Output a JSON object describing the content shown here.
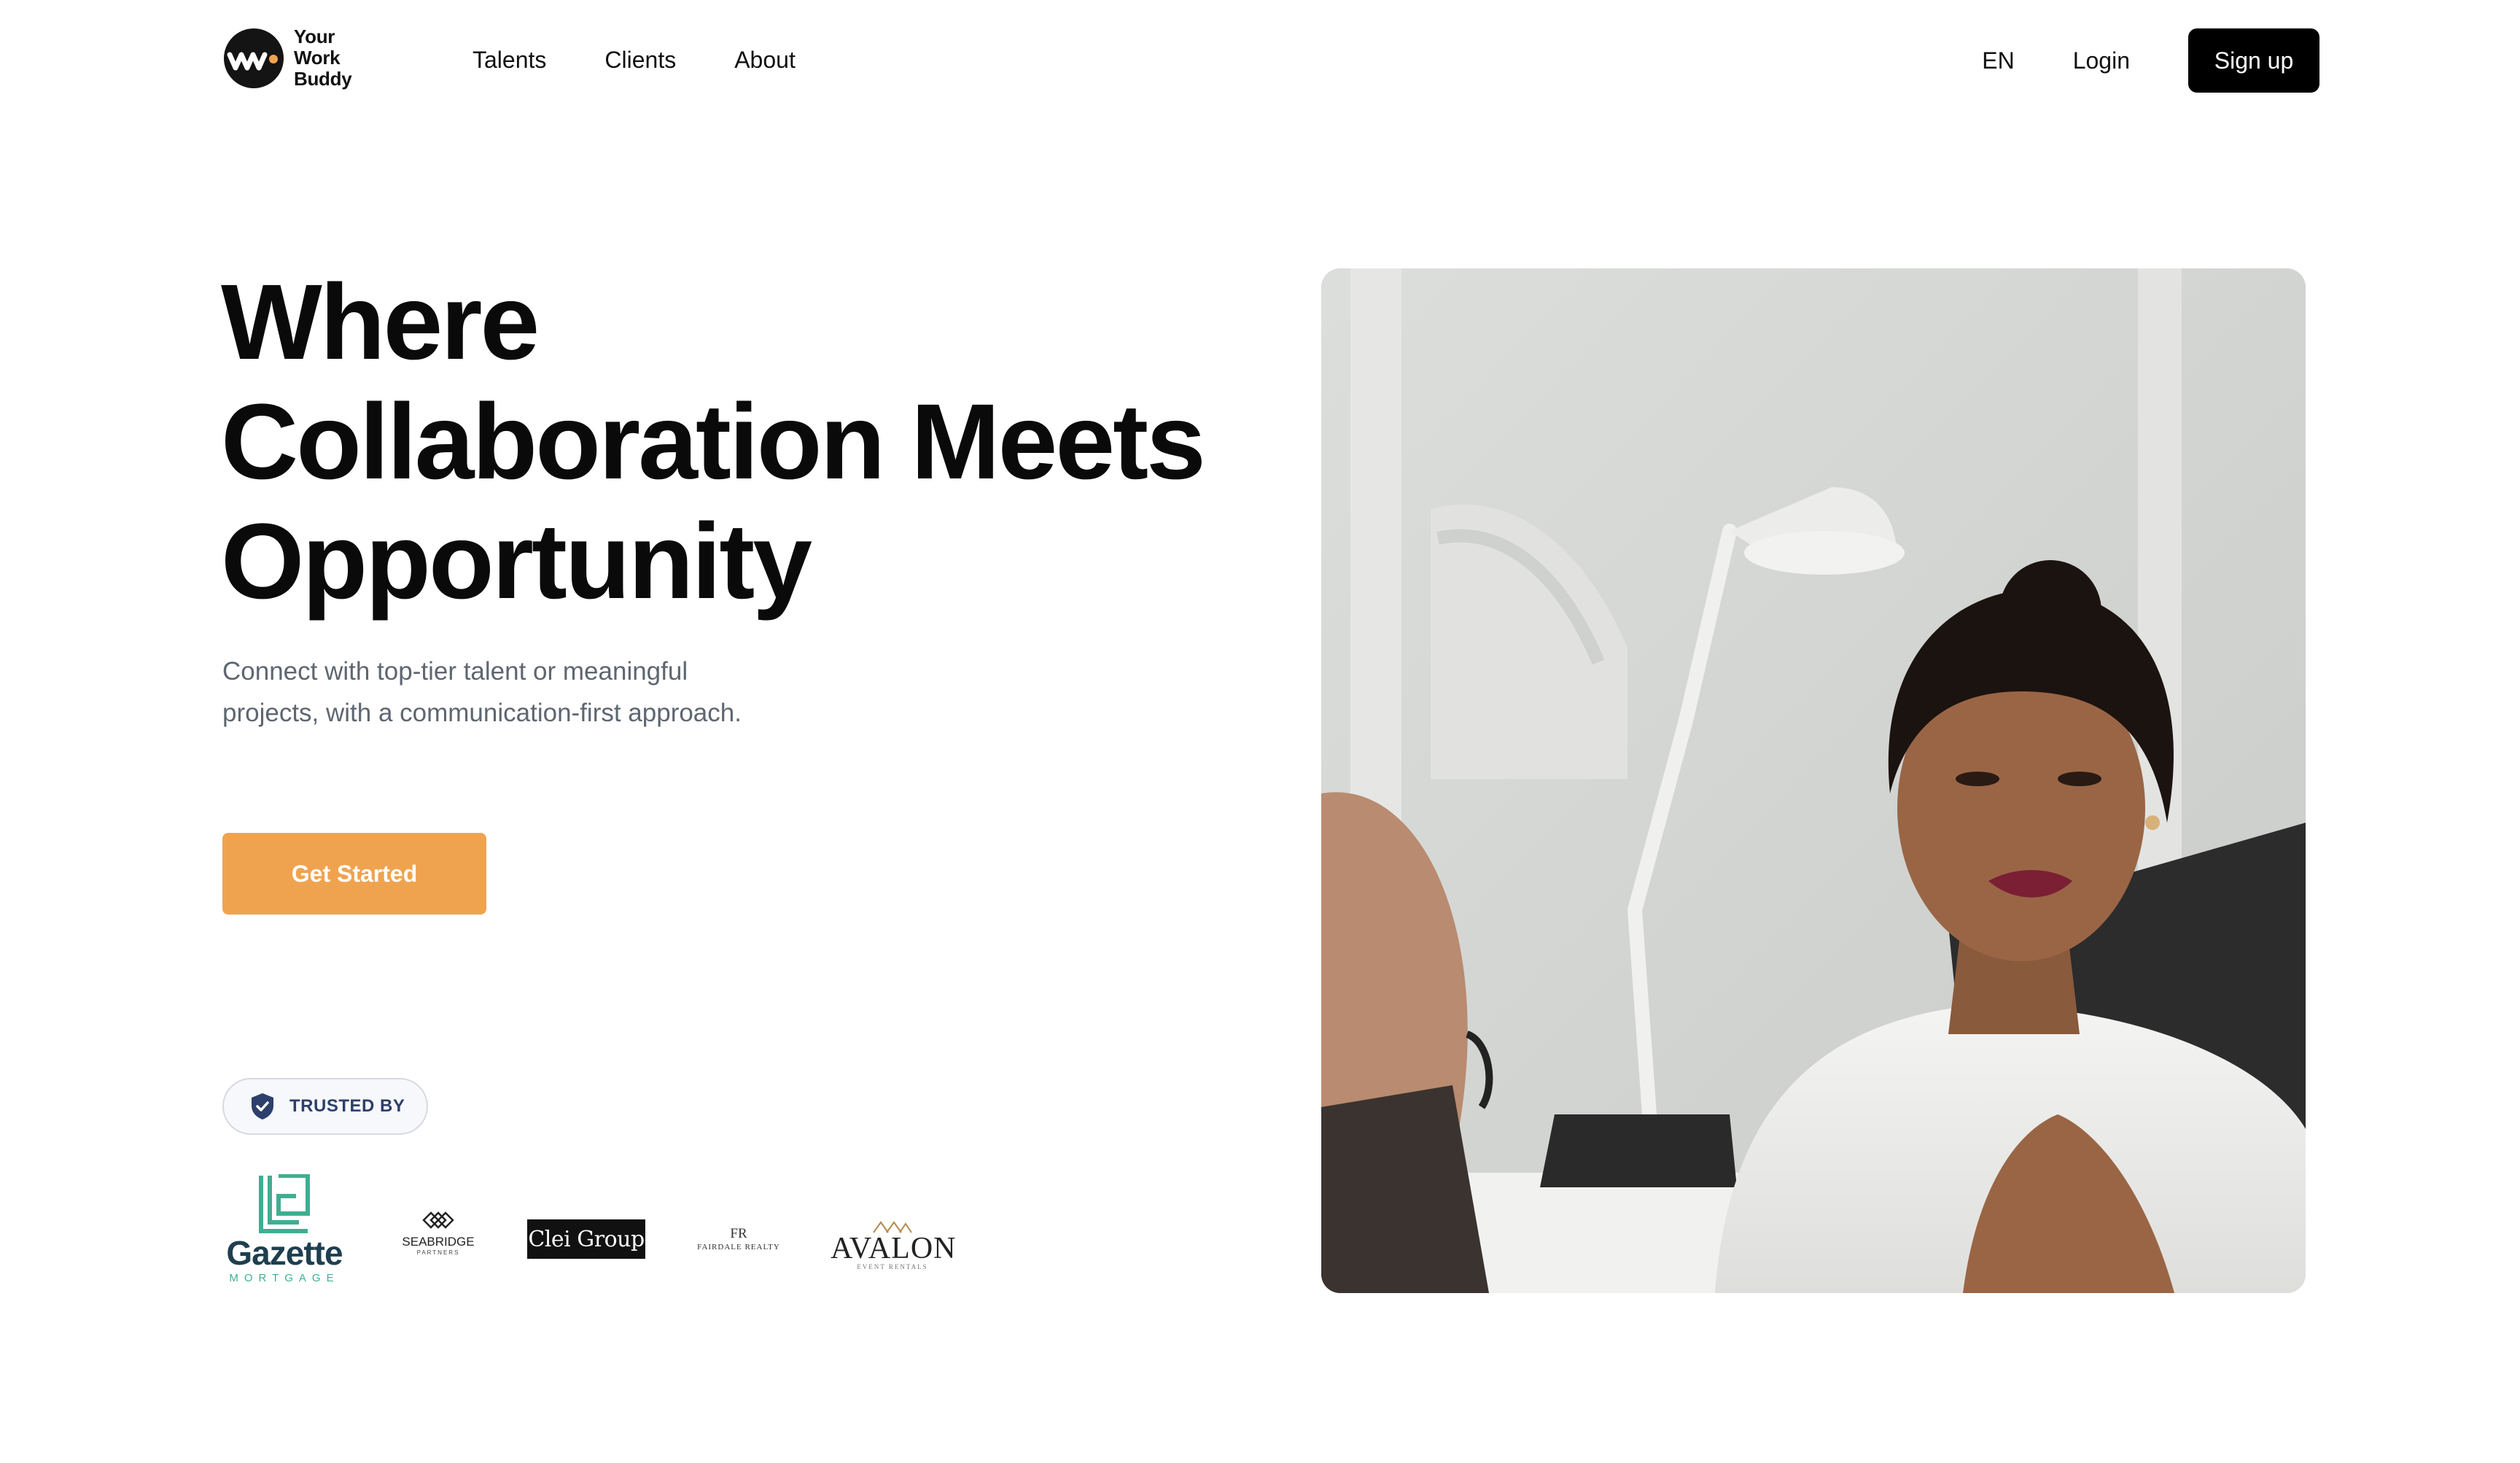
{
  "brand": {
    "logo_lines": [
      "Your",
      "Work",
      "Buddy"
    ],
    "logo_icon": "ywb-logo-icon"
  },
  "nav": {
    "items": [
      "Talents",
      "Clients",
      "About"
    ]
  },
  "header_right": {
    "language": "EN",
    "login": "Login",
    "signup": "Sign up"
  },
  "hero": {
    "title_lines": [
      "Where",
      "Collaboration Meets",
      "Opportunity"
    ],
    "subtitle": "Connect with top-tier talent or meaningful projects, with a communication-first approach.",
    "cta": "Get Started"
  },
  "trusted": {
    "label": "TRUSTED BY",
    "icon": "shield-check-icon",
    "clients": [
      {
        "name": "Gazette",
        "sub": "MORTGAGE"
      },
      {
        "name": "SEABRIDGE",
        "sub": "PARTNERS"
      },
      {
        "name": "Clei Group"
      },
      {
        "name": "FAIRDALE REALTY",
        "sub": "FR"
      },
      {
        "name": "AVALON",
        "sub": "EVENT RENTALS"
      }
    ]
  },
  "colors": {
    "accent": "#f0a34f",
    "primary_button": "#000000",
    "badge_text": "#2d3f6b",
    "subtitle_text": "#5e6670"
  },
  "photo": {
    "description_icon": "hero-photo"
  }
}
